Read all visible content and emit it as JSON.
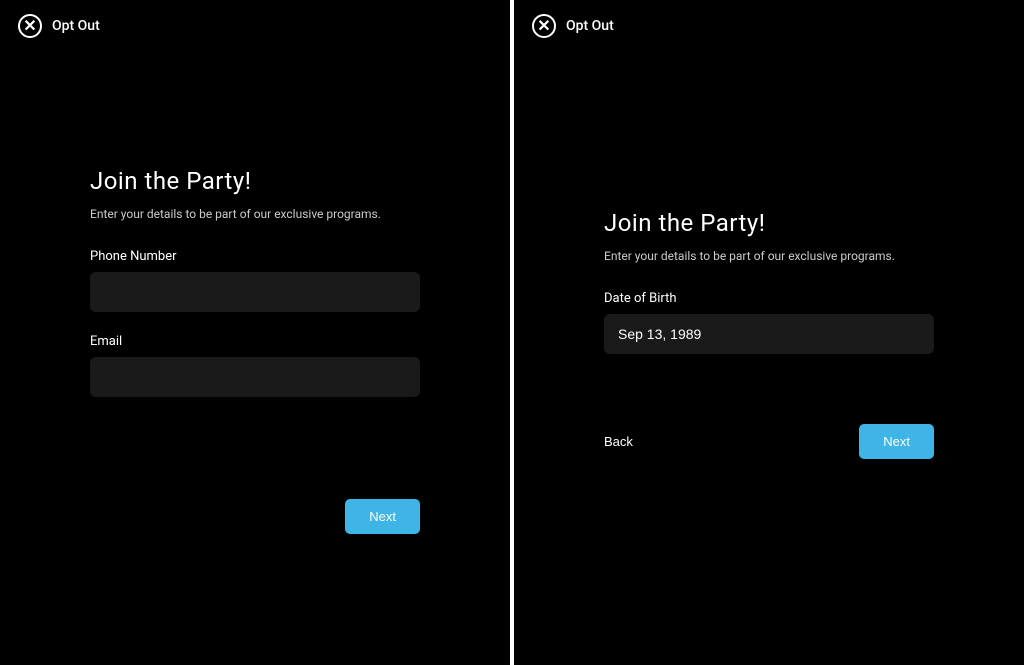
{
  "common": {
    "optOut": "Opt Out",
    "title": "Join the Party!",
    "subtitle": "Enter your details to be part of our exclusive programs."
  },
  "left": {
    "phoneLabel": "Phone Number",
    "phoneValue": "",
    "emailLabel": "Email",
    "emailValue": "",
    "next": "Next"
  },
  "right": {
    "dobLabel": "Date of Birth",
    "dobValue": "Sep 13, 1989",
    "back": "Back",
    "next": "Next"
  },
  "colors": {
    "accent": "#3FB4E6",
    "background": "#000000",
    "inputBg": "#1a1a1a"
  }
}
